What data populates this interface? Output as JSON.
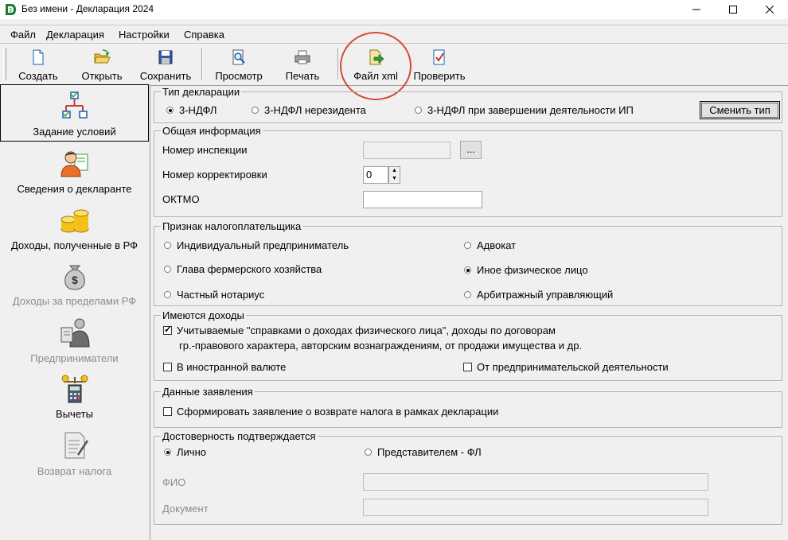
{
  "window": {
    "title": "Без имени - Декларация 2024"
  },
  "menu": [
    "Файл",
    "Декларация",
    "Настройки",
    "Справка"
  ],
  "toolbar": {
    "create": "Создать",
    "open": "Открыть",
    "save": "Сохранить",
    "preview": "Просмотр",
    "print": "Печать",
    "xml": "Файл xml",
    "check": "Проверить"
  },
  "sidebar": {
    "conditions": "Задание условий",
    "declarant": "Сведения о декларанте",
    "income_rf": "Доходы, полученные в РФ",
    "income_abroad": "Доходы за пределами РФ",
    "entrepreneurs": "Предприниматели",
    "deductions": "Вычеты",
    "refund": "Возврат налога"
  },
  "decl_type": {
    "title": "Тип декларации",
    "opt1": "3-НДФЛ",
    "opt2": "3-НДФЛ нерезидента",
    "opt3": "3-НДФЛ при завершении деятельности ИП",
    "change_btn": "Сменить тип"
  },
  "general": {
    "title": "Общая информация",
    "inspection_label": "Номер инспекции",
    "inspection_value": "",
    "browse": "...",
    "correction_label": "Номер корректировки",
    "correction_value": "0",
    "oktmo_label": "ОКТМО",
    "oktmo_value": ""
  },
  "taxpayer": {
    "title": "Признак налогоплательщика",
    "ip": "Индивидуальный предприниматель",
    "farm": "Глава фермерского хозяйства",
    "notary": "Частный нотариус",
    "lawyer": "Адвокат",
    "other": "Иное физическое лицо",
    "arbitr": "Арбитражный управляющий"
  },
  "income": {
    "title": "Имеются доходы",
    "ref_line1": "Учитываемые \"справками о доходах физического лица\", доходы по договорам",
    "ref_line2": "гр.-правового характера, авторским вознаграждениям, от продажи имущества и др.",
    "foreign": "В иностранной валюте",
    "business": "От предпринимательской деятельности"
  },
  "statement": {
    "title": "Данные заявления",
    "form": "Сформировать заявление о возврате налога в рамках декларации"
  },
  "authenticity": {
    "title": "Достоверность подтверждается",
    "personal": "Лично",
    "representative": "Представителем - ФЛ",
    "fio_label": "ФИО",
    "fio_value": "",
    "doc_label": "Документ",
    "doc_value": ""
  },
  "colors": {
    "annotation_circle": "#d14a3a",
    "app_icon_green": "#1e7a34"
  }
}
